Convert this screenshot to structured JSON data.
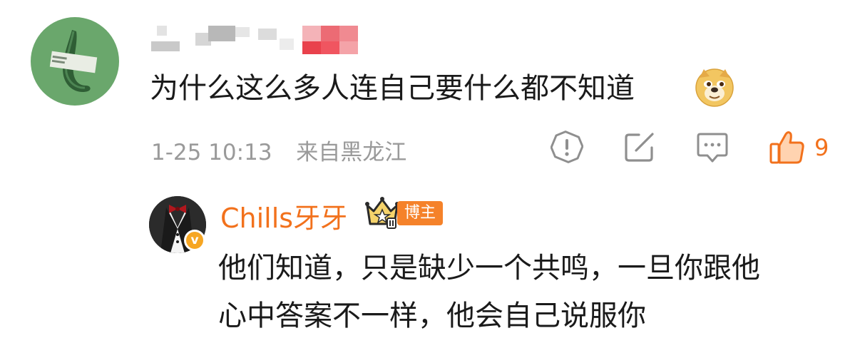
{
  "comment": {
    "text": "为什么这么多人连自己要什么都不知道",
    "emoji": "doge-emoji",
    "timestamp": "1-25 10:13",
    "location": "来自黑龙江",
    "like_count": "9"
  },
  "reply": {
    "username": "Chills牙牙",
    "badge_label": "博主",
    "text_line_1": "他们知道，只是缺少一个共鸣，一旦你跟他",
    "text_line_2": "心中答案不一样，他会自己说服你"
  },
  "colors": {
    "accent": "#f2711c",
    "meta_gray": "#9a9a9a",
    "text": "#1a1a1a"
  },
  "icons": [
    "report-icon",
    "share-icon",
    "comment-icon",
    "like-icon"
  ]
}
